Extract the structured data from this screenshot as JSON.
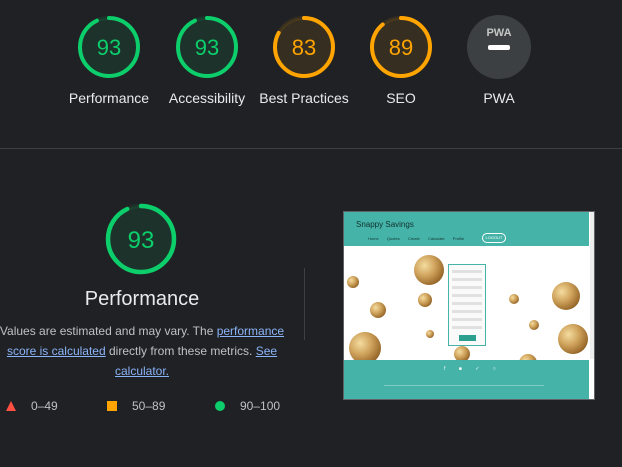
{
  "colors": {
    "pass": "#0cce6b",
    "average": "#ffa400",
    "fail": "#ff4e42",
    "pwa": "#5f6368"
  },
  "scores": [
    {
      "value": "93",
      "label": "Performance",
      "score": 0.93,
      "status": "pass"
    },
    {
      "value": "93",
      "label": "Accessibility",
      "score": 0.93,
      "status": "pass"
    },
    {
      "value": "83",
      "label": "Best Practices",
      "score": 0.83,
      "status": "average"
    },
    {
      "value": "89",
      "label": "SEO",
      "score": 0.89,
      "status": "average"
    },
    {
      "value": "",
      "label": "PWA",
      "badge": "PWA",
      "status": "pwa"
    }
  ],
  "performance": {
    "score_value": "93",
    "score": 0.93,
    "title": "Performance",
    "desc_prefix": "Values are estimated and may vary. The ",
    "link_score": "performance score is calculated",
    "desc_middle": " directly from these metrics. ",
    "link_calc": "See calculator."
  },
  "legend": [
    {
      "label": "0–49",
      "shape": "triangle-icon",
      "color": "#ff4e42"
    },
    {
      "label": "50–89",
      "shape": "square-icon",
      "color": "#ffa400"
    },
    {
      "label": "90–100",
      "shape": "circle-icon",
      "color": "#0cce6b"
    }
  ],
  "screenshot": {
    "brand": "Snappy Savings",
    "nav": [
      "Home",
      "Quotes",
      "Create",
      "Calculate",
      "Profile"
    ],
    "button": "LOGOUT",
    "footer_icons": [
      "facebook-icon",
      "linkedin-icon",
      "twitter-icon",
      "instagram-icon"
    ]
  }
}
